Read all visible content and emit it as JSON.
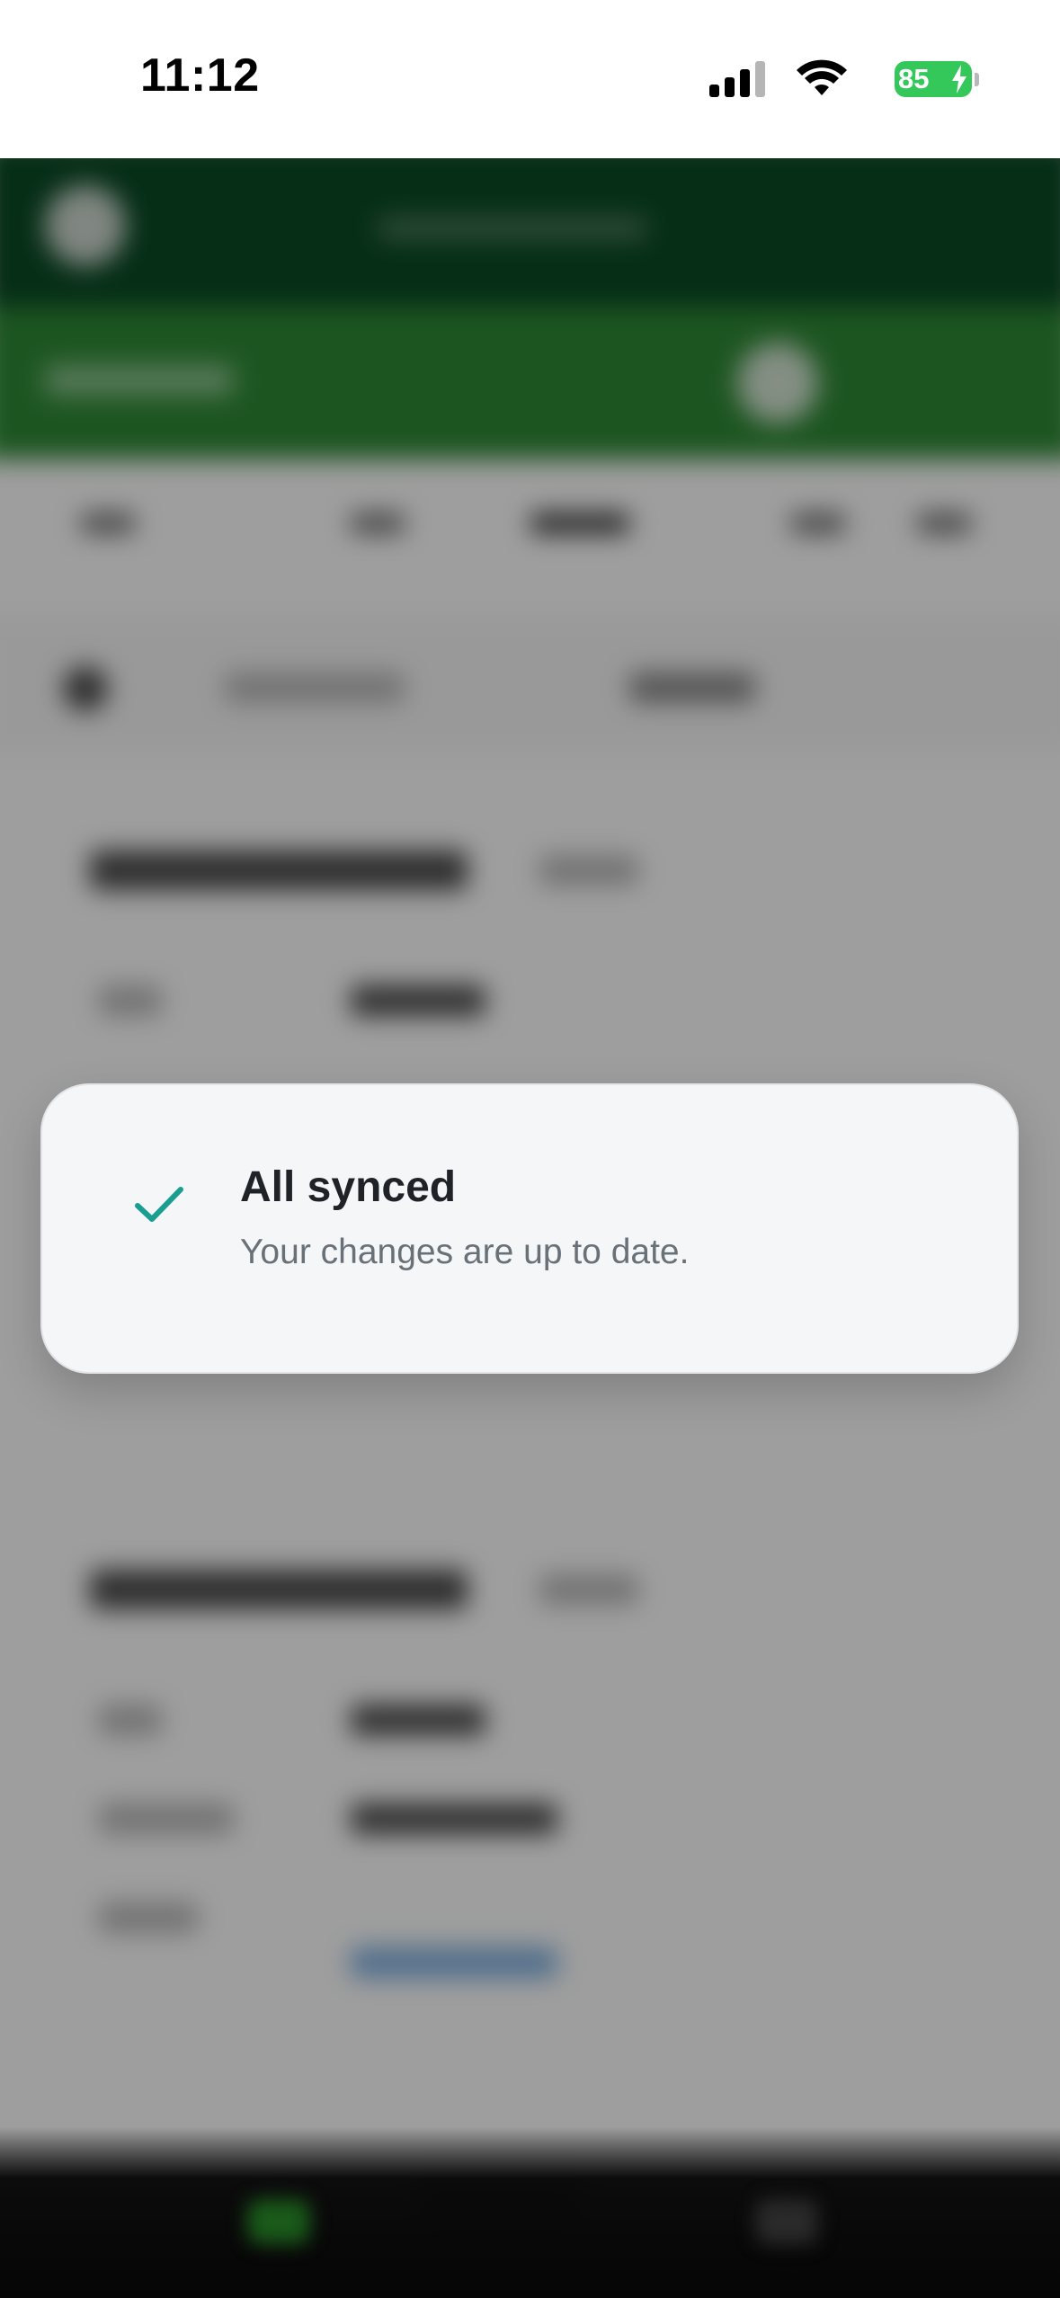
{
  "status_bar": {
    "time": "11:12",
    "battery_level": "85",
    "battery_charging": true,
    "icons": [
      "signal-icon",
      "wifi-icon",
      "battery-icon"
    ]
  },
  "sync_toast": {
    "title": "All synced",
    "subtitle": "Your changes are up to date.",
    "icon": "checkmark-icon",
    "icon_color": "#1a9e91"
  },
  "colors": {
    "app_header": "#0a4a25",
    "app_subheader": "#2f8a36",
    "toast_background": "#f5f6f8",
    "battery": "#34c759"
  }
}
